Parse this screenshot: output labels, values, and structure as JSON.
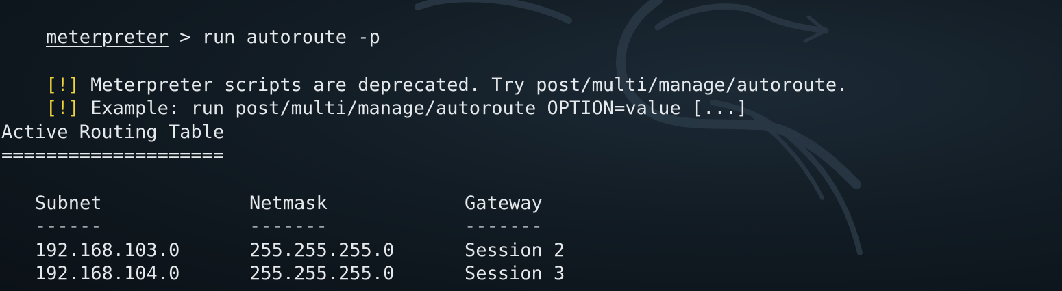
{
  "terminal": {
    "prompt": "meterpreter",
    "prompt_separator": " > ",
    "command": "run autoroute -p",
    "warnings": [
      {
        "tag": "[!]",
        "text": " Meterpreter scripts are deprecated. Try post/multi/manage/autoroute."
      },
      {
        "tag": "[!]",
        "text": " Example: run post/multi/manage/autoroute OPTION=value [...]"
      }
    ],
    "table_title": "Active Routing Table",
    "table_title_rule": "====================",
    "columns": [
      "Subnet",
      "Netmask",
      "Gateway"
    ],
    "column_rules": [
      "------",
      "-------",
      "-------"
    ],
    "rows": [
      [
        "192.168.103.0",
        "255.255.255.0",
        "Session 2"
      ],
      [
        "192.168.104.0",
        "255.255.255.0",
        "Session 3"
      ]
    ],
    "colors": {
      "background": "#121c24",
      "foreground": "#e6e9ec",
      "warning_bracket": "#f1d63a"
    },
    "background_art": "kali-dragon-logo"
  }
}
